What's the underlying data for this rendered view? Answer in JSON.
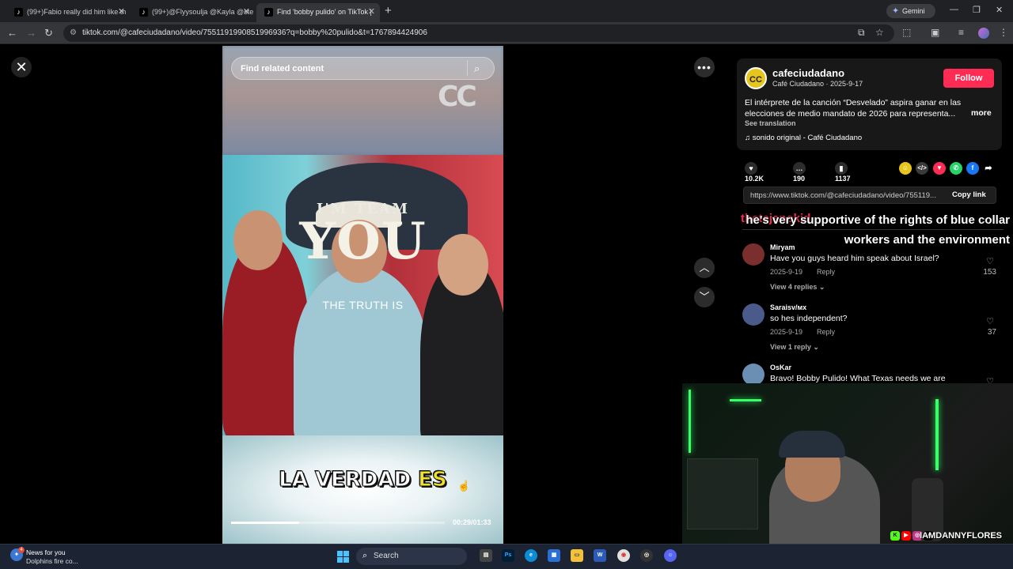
{
  "browser": {
    "tabs": [
      {
        "label": "(99+)Fabio really did him like th",
        "active": false
      },
      {
        "label": "(99+)@Flyysoulja @Kayla @ste",
        "active": false
      },
      {
        "label": "Find 'bobby pulido' on TikTok |",
        "active": true
      }
    ],
    "gemini_label": "Gemini",
    "url": "tiktok.com/@cafeciudadano/video/7551191990851996936?q=bobby%20pulido&t=1767894424906"
  },
  "video": {
    "search_placeholder": "Find related content",
    "logo_text": "CC",
    "overlay_team": "I'M TEAM",
    "overlay_you": "YOU",
    "caption_en": "THE TRUTH IS",
    "caption_es_main": "LA VERDAD",
    "caption_es_highlight": "ES",
    "time": "00:29/01:33",
    "progress": 0.32
  },
  "post": {
    "avatar_text": "CC",
    "username": "cafeciudadano",
    "byline": "Café Ciudadano · 2025-9-17",
    "follow_label": "Follow",
    "description": "El intérprete de la canción “Desvelado” aspira ganar en las elecciones de medio mandato de 2026 para representa...",
    "more_label": "more",
    "see_translation": "See translation",
    "sound": "sonido original - Café Ciudadano",
    "likes": "10.2K",
    "comments": "190",
    "saves": "1137",
    "link": "https://www.tiktok.com/@cafeciudadano/video/755119...",
    "copy_link_label": "Copy link"
  },
  "stream_overlay": {
    "user": "thetejanokid",
    "message": "he's very supportive of the rights of blue collar workers and the environment"
  },
  "comments": [
    {
      "name": "Miryam",
      "text": "Have you guys heard him speak about Israel?",
      "date": "2025-9-19",
      "reply": "Reply",
      "likes": "153",
      "replies": "View 4 replies"
    },
    {
      "name": "Saraisv/мх",
      "text": "so hes independent?",
      "date": "2025-9-19",
      "reply": "Reply",
      "likes": "37",
      "replies": "View 1 reply"
    },
    {
      "name": "OsKar",
      "text": "Bravo! Bobby Pulido! What Texas needs we are",
      "date": "",
      "reply": "",
      "likes": "",
      "replies": ""
    }
  ],
  "webcam": {
    "handle": "IAMDANNYFLORES"
  },
  "taskbar": {
    "news_title": "News for you",
    "news_subtitle": "Dolphins fire co...",
    "news_badge": "4",
    "search_label": "Search"
  },
  "colors": {
    "accent": "#fe2c55",
    "caption_highlight": "#f0e02a"
  }
}
